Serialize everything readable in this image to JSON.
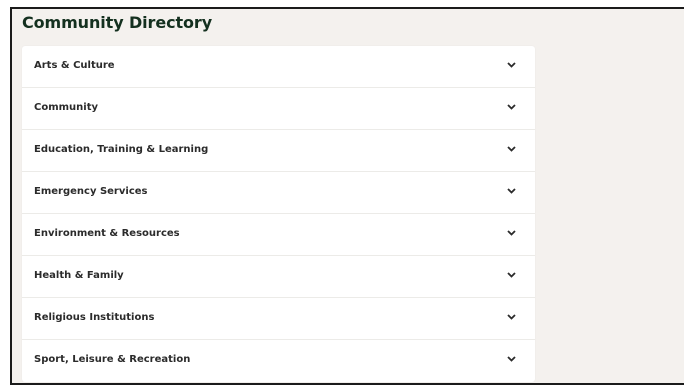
{
  "page": {
    "title": "Community Directory"
  },
  "accordion": {
    "items": [
      {
        "label": "Arts & Culture",
        "icon": "chevron-down-icon"
      },
      {
        "label": "Community",
        "icon": "chevron-down-icon"
      },
      {
        "label": "Education, Training & Learning",
        "icon": "chevron-down-icon"
      },
      {
        "label": "Emergency Services",
        "icon": "chevron-down-icon"
      },
      {
        "label": "Environment & Resources",
        "icon": "chevron-down-icon"
      },
      {
        "label": "Health & Family",
        "icon": "chevron-down-icon"
      },
      {
        "label": "Religious Institutions",
        "icon": "chevron-down-icon"
      },
      {
        "label": "Sport, Leisure & Recreation",
        "icon": "chevron-down-icon"
      }
    ]
  },
  "colors": {
    "background": "#f4f1ee",
    "title": "#14301f",
    "card": "#ffffff",
    "text": "#2b2b2b"
  }
}
